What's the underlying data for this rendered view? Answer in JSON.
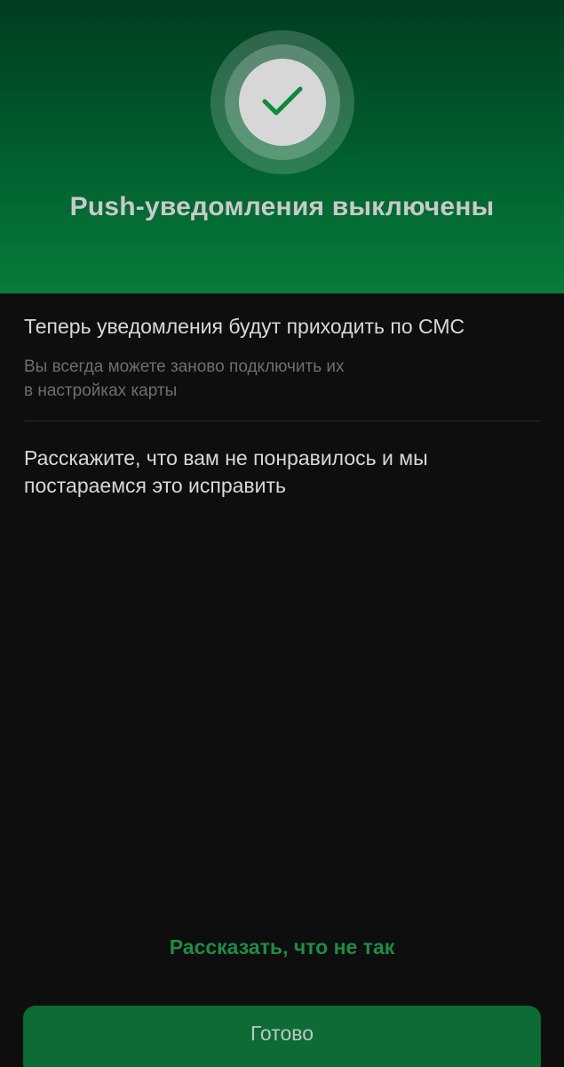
{
  "header": {
    "title": "Push-уведомления выключены",
    "status_icon": "check-icon",
    "accent_color": "#1f8c46"
  },
  "info": {
    "title": "Теперь уведомления будут приходить по СМС",
    "subtitle_line1": "Вы всегда можете заново подключить их",
    "subtitle_line2": "в настройках карты"
  },
  "feedback": {
    "text_line1": "Расскажите, что вам не понравилось и мы",
    "text_line2": "постараемся это исправить",
    "link_label": "Рассказать, что не так"
  },
  "actions": {
    "done_label": "Готово"
  }
}
